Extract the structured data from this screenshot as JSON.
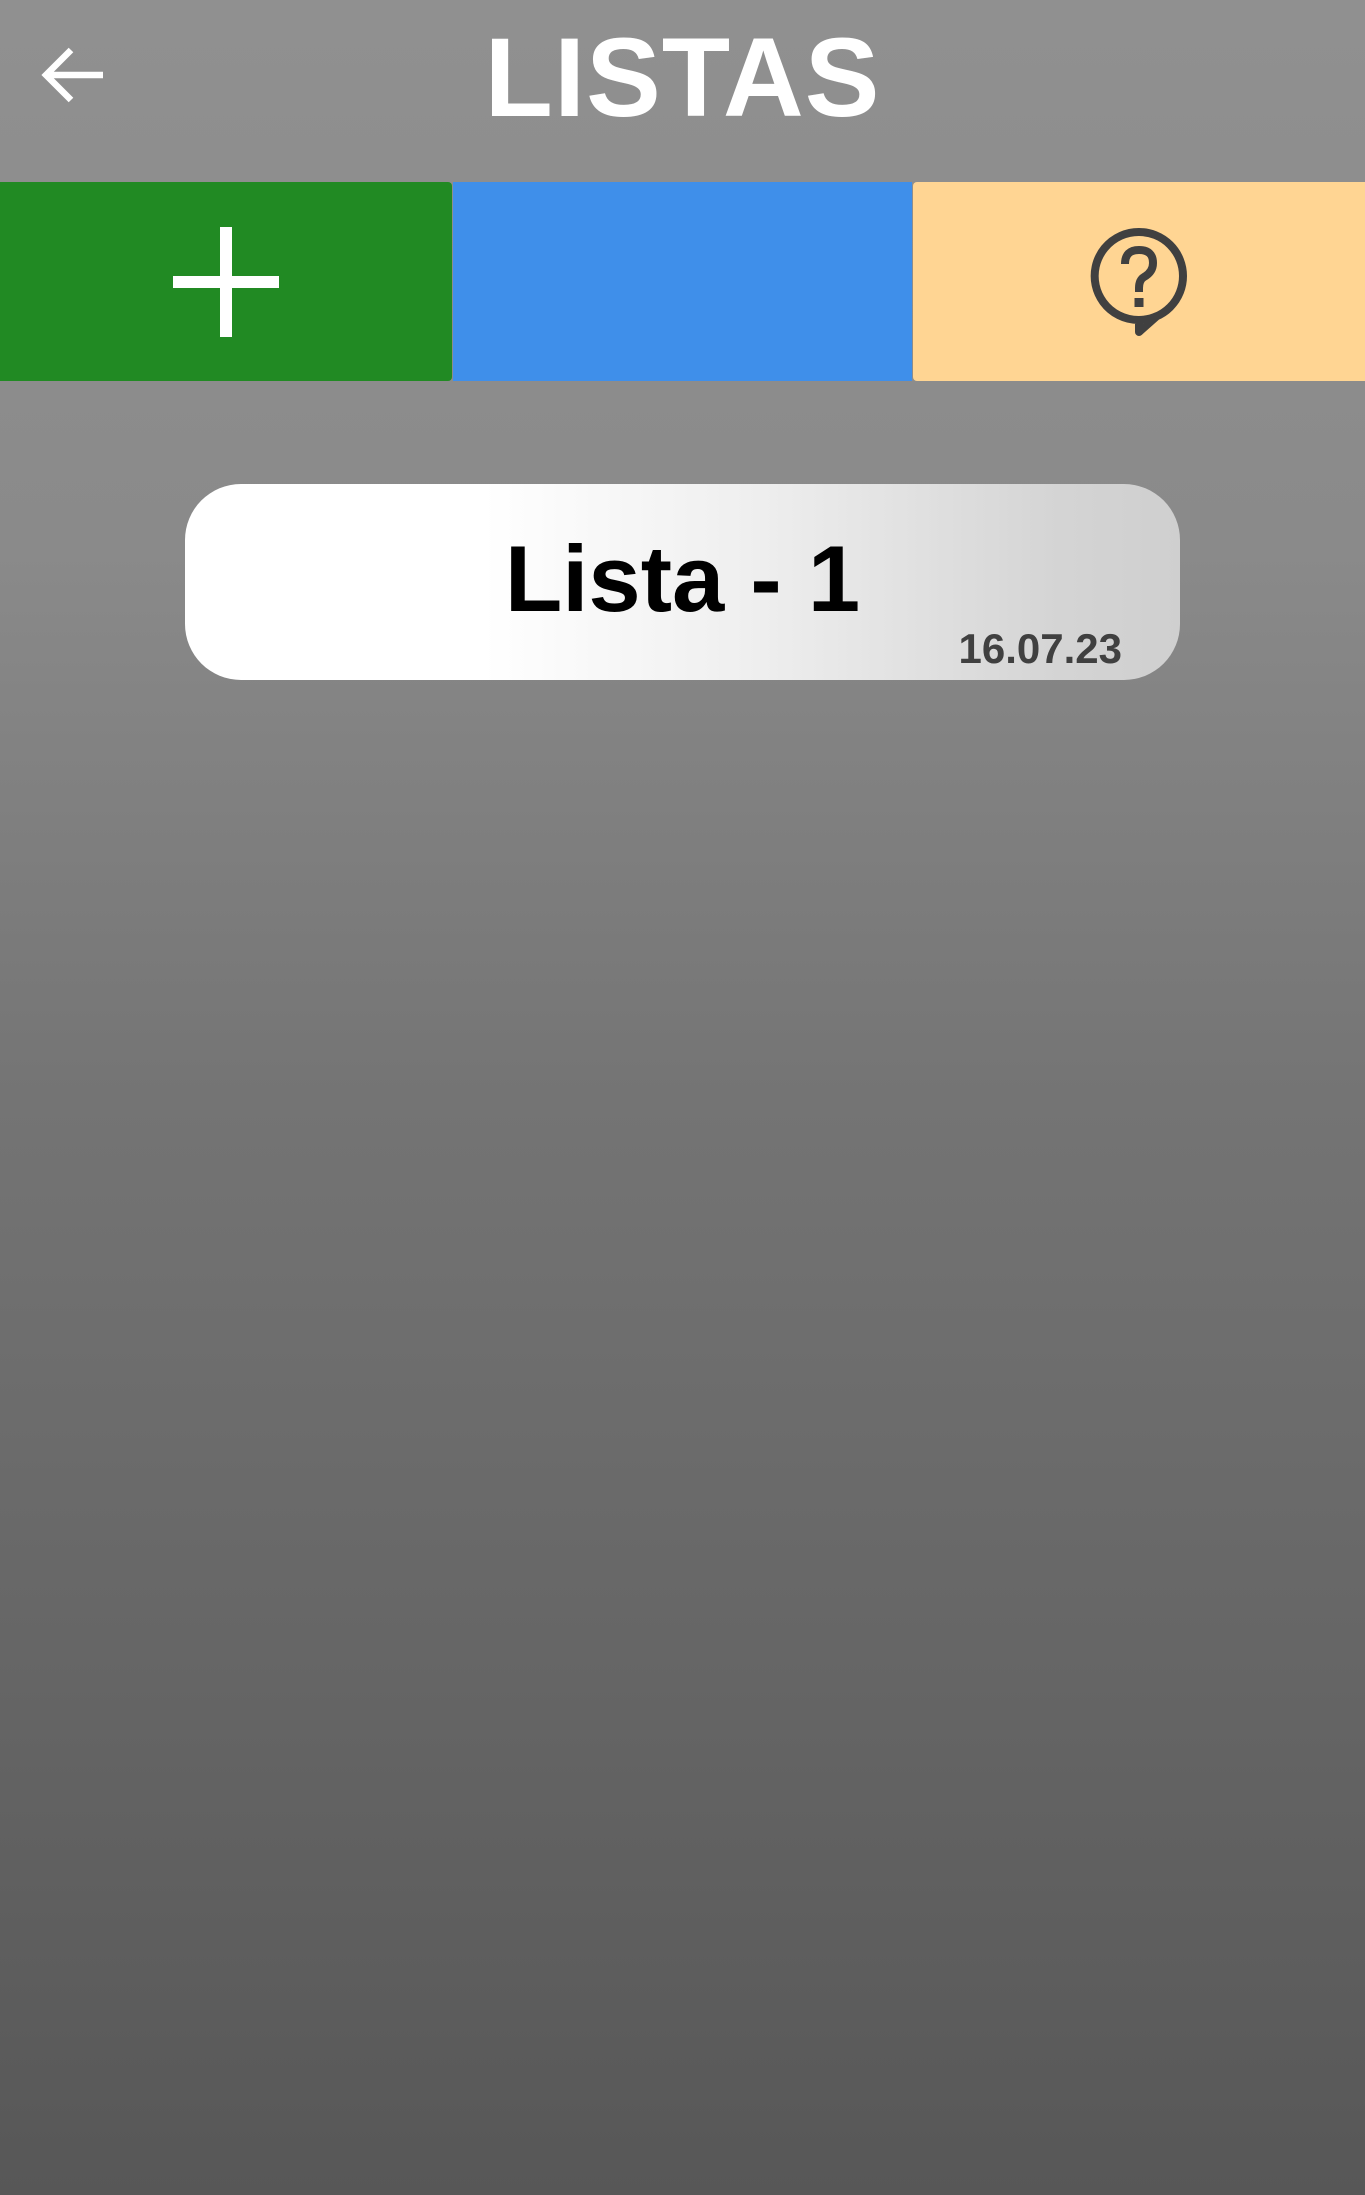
{
  "header": {
    "title": "LISTAS",
    "back_icon": "arrow-left-icon"
  },
  "toolbar": {
    "add_button": {
      "icon": "plus-icon",
      "color": "#218a23"
    },
    "middle_button": {
      "color": "#3f8fea"
    },
    "help_button": {
      "icon": "help-bubble-icon",
      "color": "#ffd593"
    }
  },
  "lists": [
    {
      "name": "Lista - 1",
      "date": "16.07.23"
    }
  ],
  "colors": {
    "title_text": "#ffffff",
    "background_top": "#909090",
    "background_bottom": "#575757",
    "card_text": "#000000",
    "card_date_text": "#404040"
  }
}
